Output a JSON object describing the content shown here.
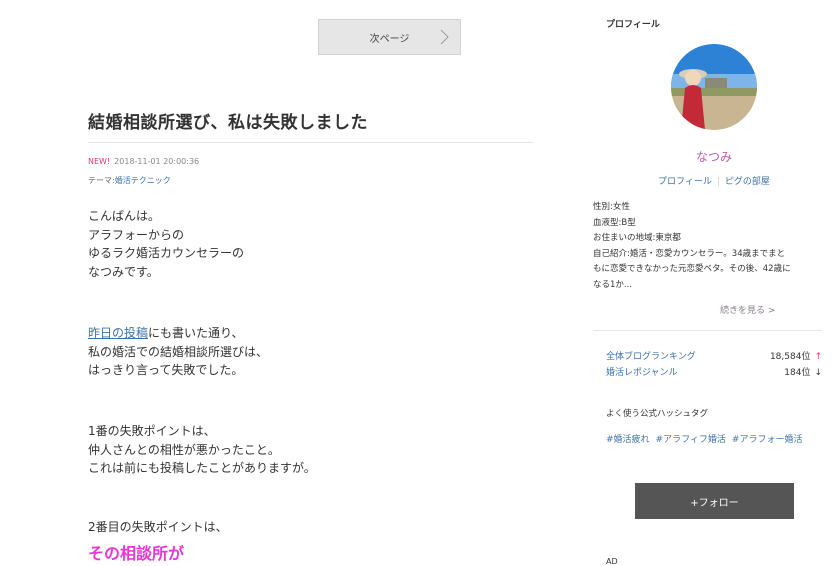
{
  "nav": {
    "next_page_label": "次ページ"
  },
  "post": {
    "title": "結婚相談所選び、私は失敗しました",
    "new_badge": "NEW!",
    "datetime": "2018-11-01 20:00:36",
    "theme_prefix": "テーマ:",
    "theme_link": "婚活テクニック",
    "p1": [
      "こんばんは。",
      "アラフォーからの",
      "ゆるラク婚活カウンセラーの",
      "なつみです。"
    ],
    "p2_link": "昨日の投稿",
    "p2_first_rest": "にも書いた通り、",
    "p2": [
      "私の婚活での結婚相談所選びは、",
      "はっきり言って失敗でした。"
    ],
    "p3": [
      "1番の失敗ポイントは、",
      "仲人さんとの相性が悪かったこと。",
      "これは前にも投稿したことがありますが。"
    ],
    "p4": [
      "2番目の失敗ポイントは、"
    ],
    "highlight": "その相談所が"
  },
  "sidebar": {
    "heading": "プロフィール",
    "name": "なつみ",
    "link_profile": "プロフィール",
    "link_room": "ピグの部屋",
    "info": [
      "性別:女性",
      "血液型:B型",
      "お住まいの地域:東京都",
      "自己紹介:婚活・恋愛カウンセラー。34歳までまと",
      "もに恋愛できなかった元恋愛ベタ。その後、42歳に",
      "なる1か..."
    ],
    "more_label": "続きを見る >",
    "ranking": [
      {
        "label": "全体ブログランキング",
        "value": "18,584位",
        "trend": "↑"
      },
      {
        "label": "婚活レポジャンル",
        "value": "184位",
        "trend": "↓"
      }
    ],
    "hashtag_heading": "よく使う公式ハッシュタグ",
    "hashtags": [
      "#婚活疲れ",
      "#アラフィフ婚活",
      "#アラフォー婚活"
    ],
    "follow_label": "+フォロー",
    "ad_label": "AD"
  },
  "colors": {
    "accent_pink": "#e637d2",
    "link_blue": "#3f72a8",
    "new_pink": "#e8327a",
    "button_dark": "#555555"
  }
}
